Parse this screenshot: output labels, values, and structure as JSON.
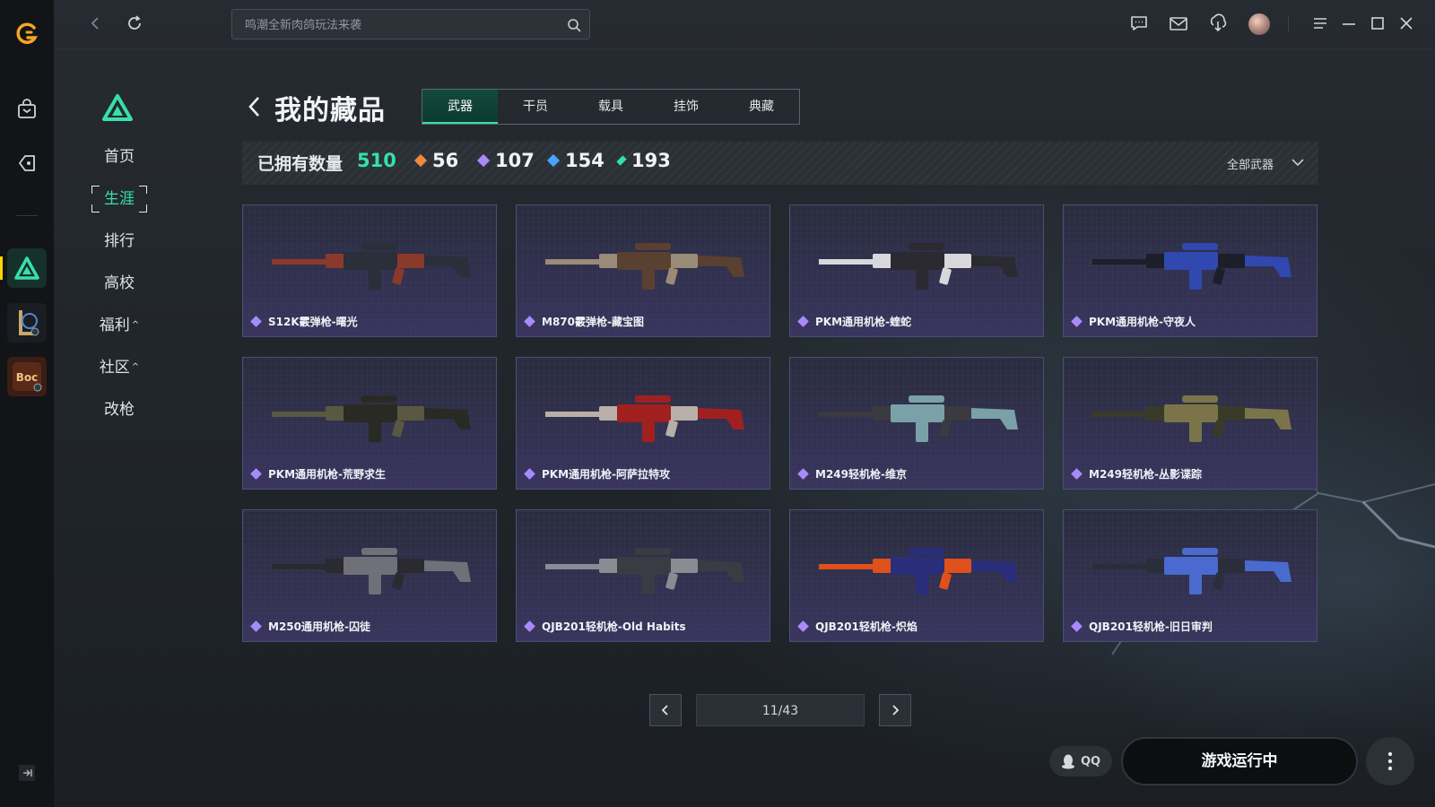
{
  "app": {
    "brand_color": "#f5a623",
    "accent": "#37e0a8"
  },
  "topbar": {
    "search_placeholder": "鸣潮全新肉鸽玩法来袭",
    "icons": [
      "back-icon",
      "refresh-icon",
      "search-icon",
      "chat-icon",
      "mail-icon",
      "download-icon",
      "avatar",
      "menu-icon",
      "minimize-icon",
      "maximize-icon",
      "close-icon"
    ]
  },
  "sidebar": {
    "items": [
      {
        "label": "首页"
      },
      {
        "label": "生涯",
        "active": true
      },
      {
        "label": "排行"
      },
      {
        "label": "高校"
      },
      {
        "label": "福利",
        "caret": "^"
      },
      {
        "label": "社区",
        "caret": "^"
      },
      {
        "label": "改枪"
      }
    ]
  },
  "header": {
    "title": "我的藏品",
    "tabs": [
      "武器",
      "干员",
      "载具",
      "挂饰",
      "典藏"
    ],
    "active_tab": "武器"
  },
  "stats": {
    "label": "已拥有数量",
    "total": "510",
    "counts": [
      {
        "value": "56",
        "color": "#f0883e"
      },
      {
        "value": "107",
        "color": "#a78bfa"
      },
      {
        "value": "154",
        "color": "#4aa3ff"
      },
      {
        "value": "193",
        "color": "#37e0a8"
      }
    ],
    "filter": "全部武器"
  },
  "items": [
    {
      "name": "S12K霰弹枪-曙光",
      "colors": [
        "#8a3a2a",
        "#2a2f3a"
      ]
    },
    {
      "name": "M870霰弹枪-藏宝图",
      "colors": [
        "#9a8a78",
        "#5a4030"
      ]
    },
    {
      "name": "PKM通用机枪-蝰蛇",
      "colors": [
        "#d8d8dc",
        "#2a2a30"
      ]
    },
    {
      "name": "PKM通用机枪-守夜人",
      "colors": [
        "#1c1e2a",
        "#3048b0"
      ]
    },
    {
      "name": "PKM通用机枪-荒野求生",
      "colors": [
        "#5a5840",
        "#2a2a24"
      ]
    },
    {
      "name": "PKM通用机枪-阿萨拉特攻",
      "colors": [
        "#b8b0a8",
        "#a02020"
      ]
    },
    {
      "name": "M249轻机枪-维京",
      "colors": [
        "#3a3a40",
        "#7aa0a8"
      ]
    },
    {
      "name": "M249轻机枪-丛影谍踪",
      "colors": [
        "#3a3a28",
        "#7a7448"
      ]
    },
    {
      "name": "M250通用机枪-囚徒",
      "colors": [
        "#2a2a30",
        "#707078"
      ]
    },
    {
      "name": "QJB201轻机枪-Old Habits",
      "colors": [
        "#8a8c94",
        "#3a3c44"
      ]
    },
    {
      "name": "QJB201轻机枪-炽焰",
      "colors": [
        "#e0501a",
        "#2a2e7a"
      ]
    },
    {
      "name": "QJB201轻机枪-旧日审判",
      "colors": [
        "#2a2e3a",
        "#4a6ad0"
      ]
    }
  ],
  "pager": {
    "text": "11/43"
  },
  "bottom": {
    "qq": "QQ",
    "run_label": "游戏运行中"
  }
}
